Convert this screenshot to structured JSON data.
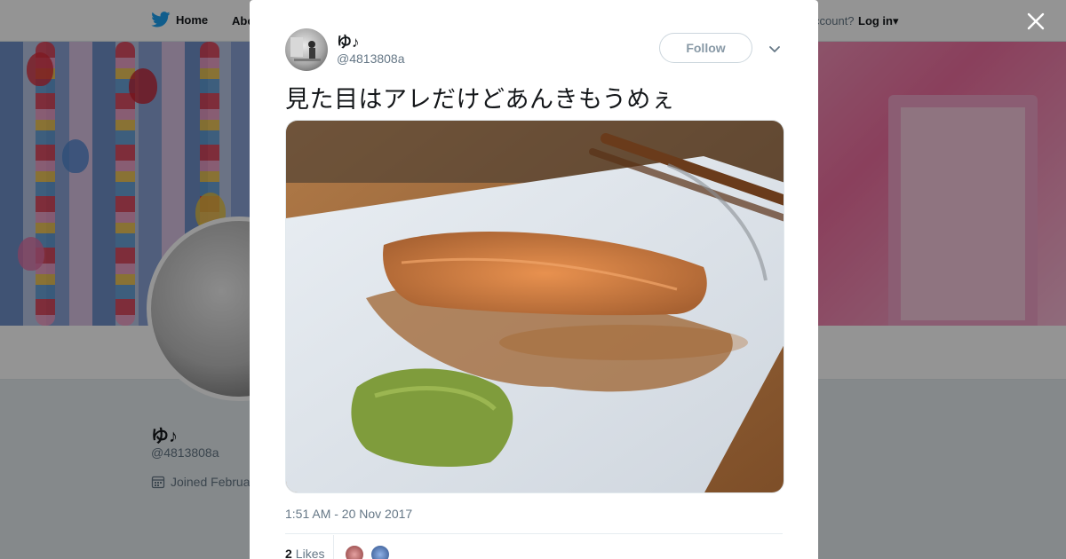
{
  "nav": {
    "home_label": "Home",
    "about_label": "Abo",
    "account_prompt": "ccount?",
    "login_label": "Log in"
  },
  "profile": {
    "name": "ゆ♪",
    "handle": "@4813808a",
    "joined": "Joined Februa"
  },
  "tweet": {
    "author_name": "ゆ♪",
    "author_handle": "@4813808a",
    "follow_label": "Follow",
    "text": "見た目はアレだけどあんきもうめぇ",
    "timestamp": "1:51 AM - 20 Nov 2017",
    "likes_count": "2",
    "likes_label": "Likes"
  },
  "icons": {
    "close": "close-icon",
    "caret": "chevron-down-icon",
    "bird": "twitter-bird-icon",
    "calendar": "calendar-icon"
  },
  "colors": {
    "brand": "#1da1f2",
    "text": "#14171a",
    "muted": "#657786"
  }
}
